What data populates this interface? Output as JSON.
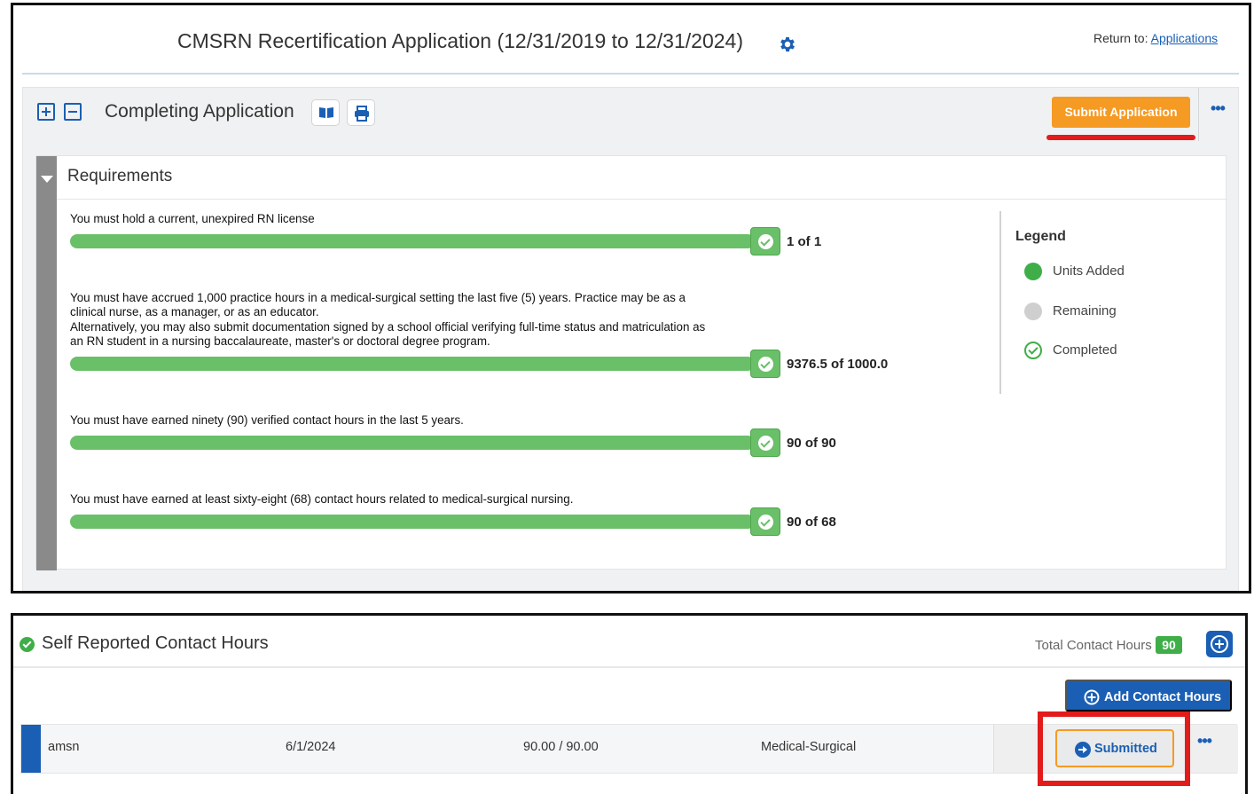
{
  "header": {
    "title": "CMSRN Recertification Application (12/31/2019 to 12/31/2024)",
    "return_label": "Return to:",
    "return_link": "Applications"
  },
  "section": {
    "title": "Completing Application",
    "submit_label": "Submit Application",
    "more_label": "•••"
  },
  "requirements": {
    "heading": "Requirements",
    "items": [
      {
        "lines": [
          "You must hold a current, unexpired RN license"
        ],
        "progress_fraction": 1.0,
        "count": "1 of 1",
        "completed": true
      },
      {
        "lines": [
          "You must have accrued 1,000 practice hours in a medical-surgical setting the last five (5) years. Practice may be as a",
          "clinical nurse, as a manager, or as an educator.",
          "Alternatively, you may also submit documentation signed by a school official verifying full-time status and matriculation as",
          "an RN student in a nursing baccalaureate, master's or doctoral degree program."
        ],
        "progress_fraction": 1.0,
        "count": "9376.5 of 1000.0",
        "completed": true
      },
      {
        "lines": [
          "You must have earned ninety (90) verified contact hours in the last 5 years."
        ],
        "progress_fraction": 1.0,
        "count": "90 of 90",
        "completed": true
      },
      {
        "lines": [
          "You must have earned at least sixty-eight (68) contact hours related to medical-surgical nursing."
        ],
        "progress_fraction": 1.0,
        "count": "90 of 68",
        "completed": true
      }
    ],
    "legend": {
      "title": "Legend",
      "items": [
        {
          "label": "Units Added",
          "icon": "filled-green-dot-icon",
          "color": "#3fae49"
        },
        {
          "label": "Remaining",
          "icon": "grey-dot-icon",
          "color": "#cfcfcf"
        },
        {
          "label": "Completed",
          "icon": "check-circle-icon",
          "color": "#3fae49"
        }
      ]
    }
  },
  "contact_hours": {
    "title": "Self Reported Contact Hours",
    "total_label": "Total Contact Hours",
    "total_value": "90",
    "add_button_label": "Add Contact Hours",
    "rows": [
      {
        "provider": "amsn",
        "date": "6/1/2024",
        "hours": "90.00 / 90.00",
        "category": "Medical-Surgical",
        "status_label": "Submitted",
        "more_label": "•••"
      }
    ]
  },
  "colors": {
    "accent_blue": "#1a5fb4",
    "submit_orange": "#f59a23",
    "progress_green": "#6abf69",
    "highlight_red": "#e21b1b"
  }
}
